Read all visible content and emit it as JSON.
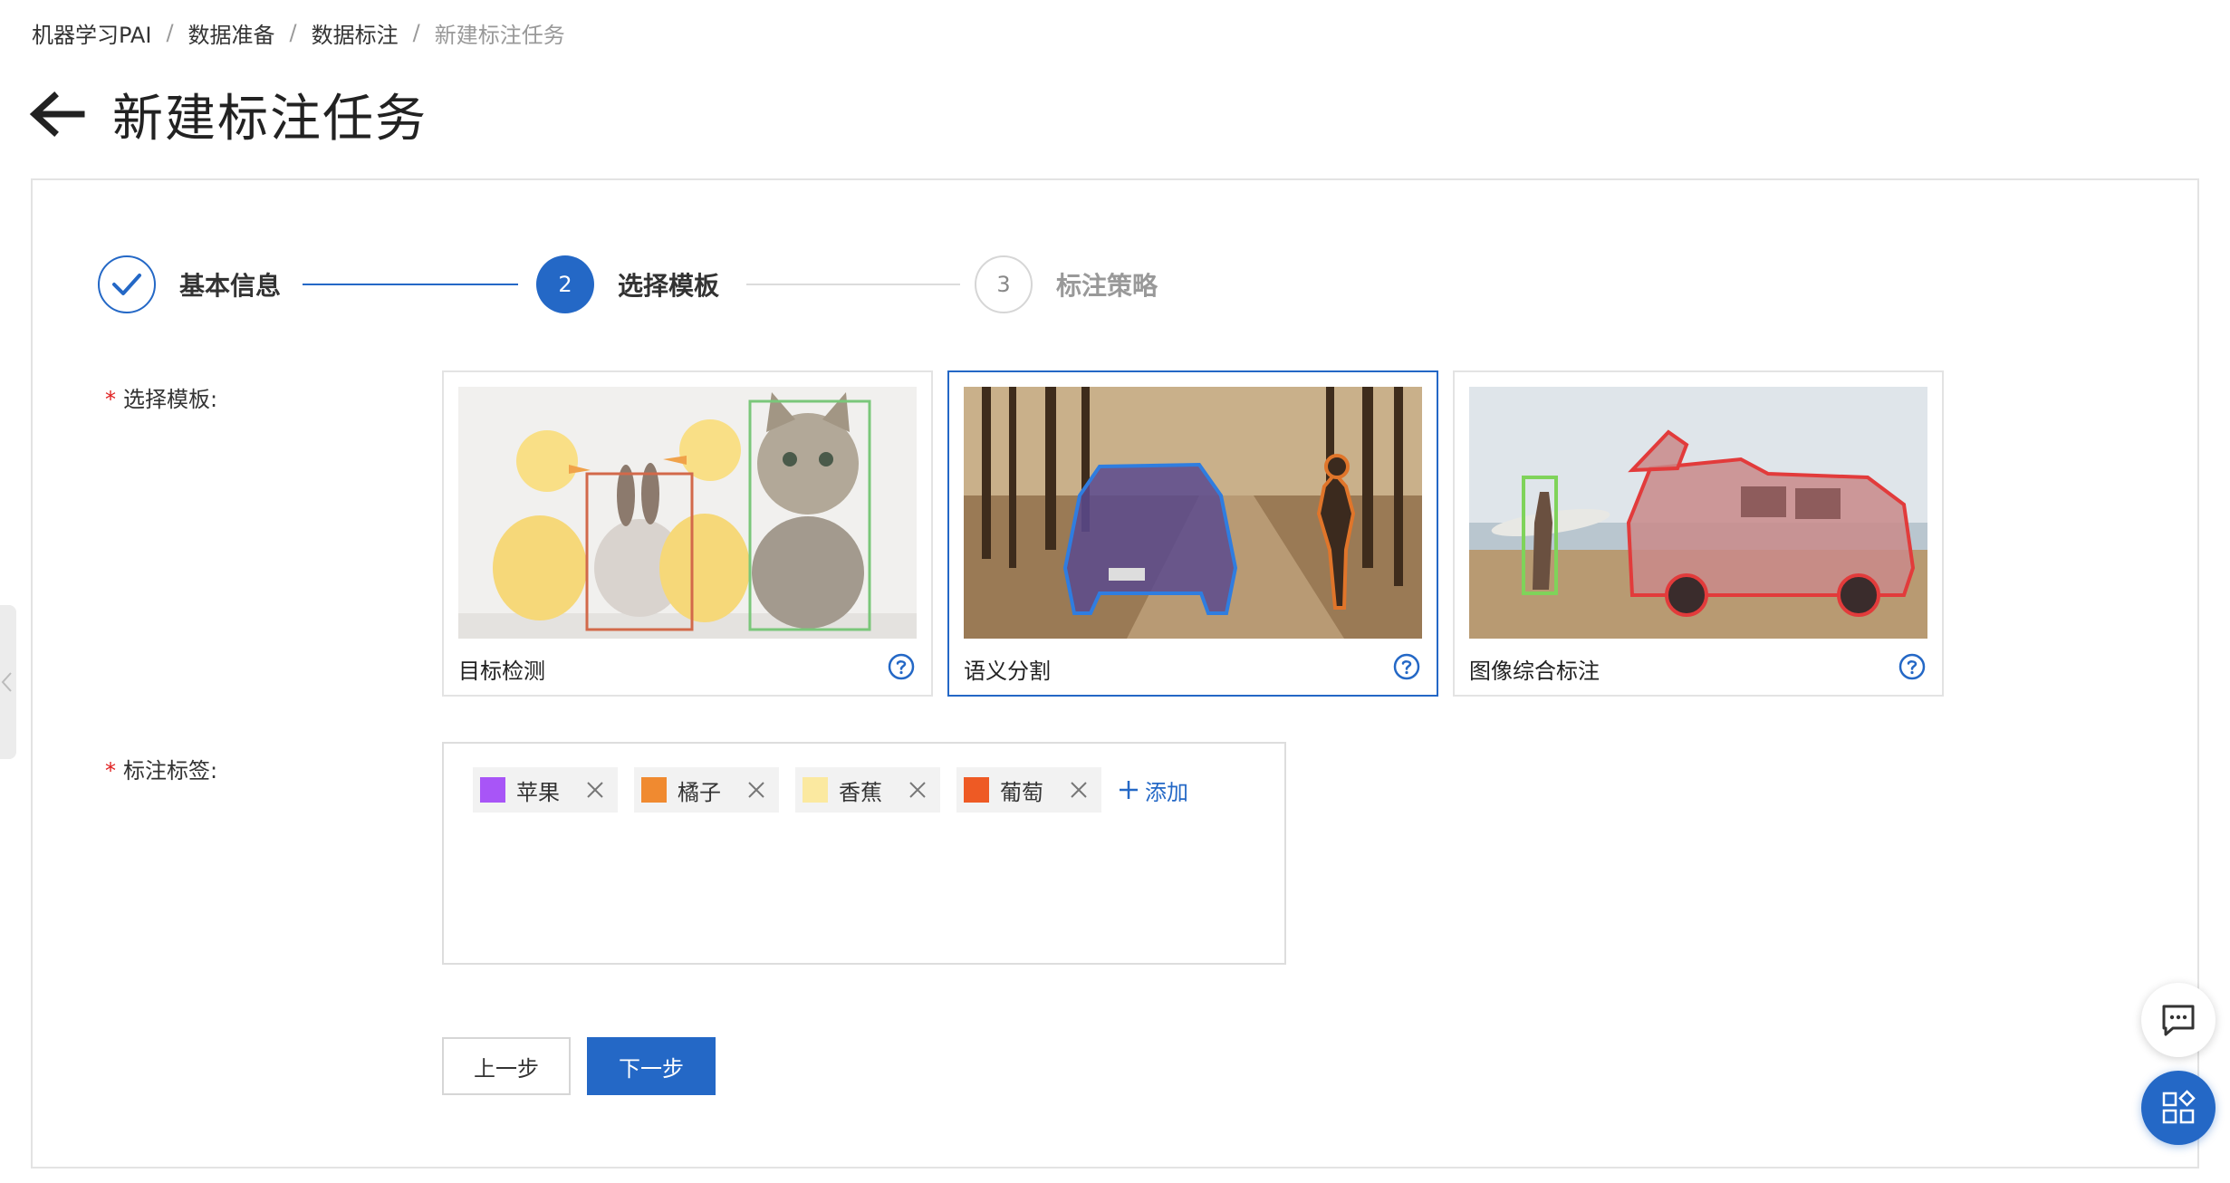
{
  "breadcrumb": {
    "items": [
      "机器学习PAI",
      "数据准备",
      "数据标注"
    ],
    "separator": "/",
    "current": "新建标注任务"
  },
  "header": {
    "title": "新建标注任务",
    "back_icon": "arrow-left-icon"
  },
  "steps": [
    {
      "number": "",
      "label": "基本信息",
      "status": "done"
    },
    {
      "number": "2",
      "label": "选择模板",
      "status": "active"
    },
    {
      "number": "3",
      "label": "标注策略",
      "status": "pending"
    }
  ],
  "form": {
    "required_mark": "*",
    "template_label": "选择模板:",
    "tags_label": "标注标签:"
  },
  "templates": [
    {
      "title": "目标检测",
      "selected": false
    },
    {
      "title": "语义分割",
      "selected": true
    },
    {
      "title": "图像综合标注",
      "selected": false
    }
  ],
  "tags": [
    {
      "label": "苹果",
      "color": "#a855f7"
    },
    {
      "label": "橘子",
      "color": "#f08a30"
    },
    {
      "label": "香蕉",
      "color": "#fbe9a0"
    },
    {
      "label": "葡萄",
      "color": "#ee5a24"
    }
  ],
  "add_tag_label": "添加",
  "buttons": {
    "prev": "上一步",
    "next": "下一步"
  },
  "colors": {
    "primary": "#2468c6",
    "required": "#e02020"
  }
}
